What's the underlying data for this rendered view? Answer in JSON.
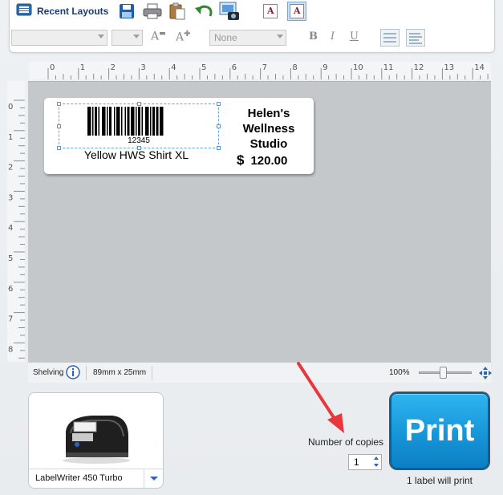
{
  "toolbar": {
    "recent_layouts": "Recent Layouts",
    "font_select": "",
    "size_select": "",
    "border_select": "None",
    "bold": "B",
    "italic": "I",
    "underline": "U",
    "grow_font": "A",
    "shrink_font": "A",
    "text_style_normal": "A",
    "text_style_outline": "A"
  },
  "ruler": {
    "top_ticks": [
      "0",
      "1",
      "2",
      "3",
      "4",
      "5",
      "6",
      "7",
      "8",
      "9",
      "10",
      "11",
      "12",
      "13",
      "14"
    ],
    "left_ticks": [
      "0",
      "1",
      "2",
      "3",
      "4",
      "5",
      "6",
      "7",
      "8"
    ]
  },
  "label": {
    "barcode_number": "12345",
    "item_name": "Yellow HWS Shirt XL",
    "store_name_line1": "Helen's",
    "store_name_line2": "Wellness",
    "store_name_line3": "Studio",
    "currency": "$",
    "price": "120.00"
  },
  "status": {
    "layout_name": "Shelving",
    "label_size": "89mm x 25mm",
    "zoom": "100%"
  },
  "printer": {
    "name": "LabelWriter 450 Turbo"
  },
  "print": {
    "copies_label": "Number of copies",
    "copies_value": "1",
    "button_label": "Print",
    "info": "1 label will print"
  },
  "colors": {
    "print_button": "#1795d8",
    "annotation_arrow": "#e8383d",
    "canvas": "#c5c8cb"
  }
}
